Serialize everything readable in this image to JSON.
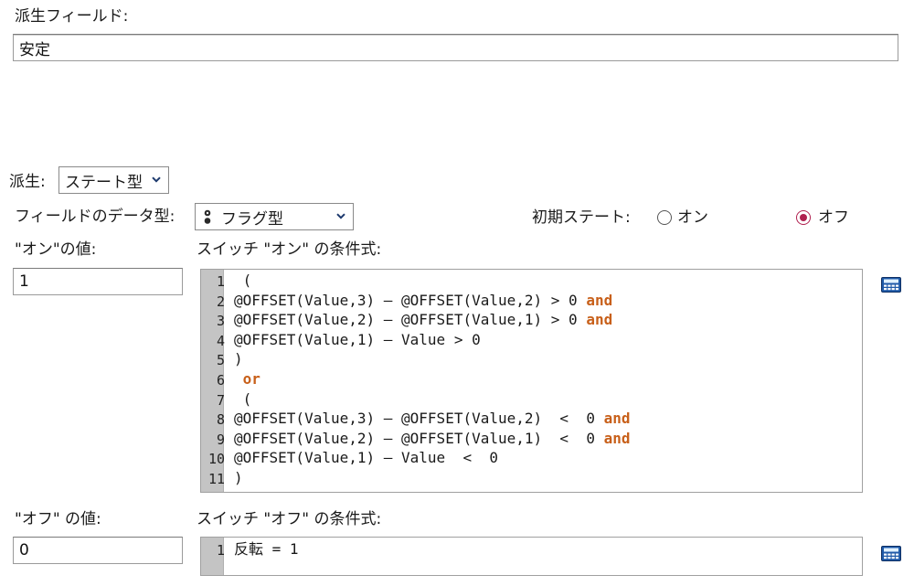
{
  "derived_field": {
    "label": "派生フィールド:",
    "value": "安定"
  },
  "derivation": {
    "label": "派生:",
    "selected": "ステート型"
  },
  "field_data_type": {
    "label": "フィールドのデータ型:",
    "selected": "フラグ型",
    "icon": "flag-type-icon"
  },
  "initial_state": {
    "label": "初期ステート:",
    "options": [
      {
        "label": "オン",
        "checked": false
      },
      {
        "label": "オフ",
        "checked": true
      }
    ]
  },
  "on_value": {
    "label": "\"オン\"の値:",
    "value": "1"
  },
  "on_condition": {
    "label": "スイッチ \"オン\" の条件式:",
    "lines": [
      [
        {
          "t": " ("
        }
      ],
      [
        {
          "t": "@OFFSET(Value,3) – @OFFSET(Value,2) > 0 "
        },
        {
          "t": "and",
          "kw": true
        }
      ],
      [
        {
          "t": "@OFFSET(Value,2) – @OFFSET(Value,1) > 0 "
        },
        {
          "t": "and",
          "kw": true
        }
      ],
      [
        {
          "t": "@OFFSET(Value,1) – Value > 0"
        }
      ],
      [
        {
          "t": ")"
        }
      ],
      [
        {
          "t": " "
        },
        {
          "t": "or",
          "kw": true
        }
      ],
      [
        {
          "t": " ("
        }
      ],
      [
        {
          "t": "@OFFSET(Value,3) – @OFFSET(Value,2)  <  0 "
        },
        {
          "t": "and",
          "kw": true
        }
      ],
      [
        {
          "t": "@OFFSET(Value,2) – @OFFSET(Value,1)  <  0 "
        },
        {
          "t": "and",
          "kw": true
        }
      ],
      [
        {
          "t": "@OFFSET(Value,1) – Value  <  0"
        }
      ],
      [
        {
          "t": ")"
        }
      ]
    ]
  },
  "off_value": {
    "label": "\"オフ\" の値:",
    "value": "0"
  },
  "off_condition": {
    "label": "スイッチ \"オフ\" の条件式:",
    "lines": [
      [
        {
          "t": "反転 = 1"
        }
      ]
    ]
  },
  "icons": {
    "expression_builder": "calculator-icon",
    "dropdown": "chevron-down-icon"
  },
  "colors": {
    "keyword": "#c8601a",
    "radio_selected": "#b0204f",
    "gutter": "#c4c4c4"
  }
}
